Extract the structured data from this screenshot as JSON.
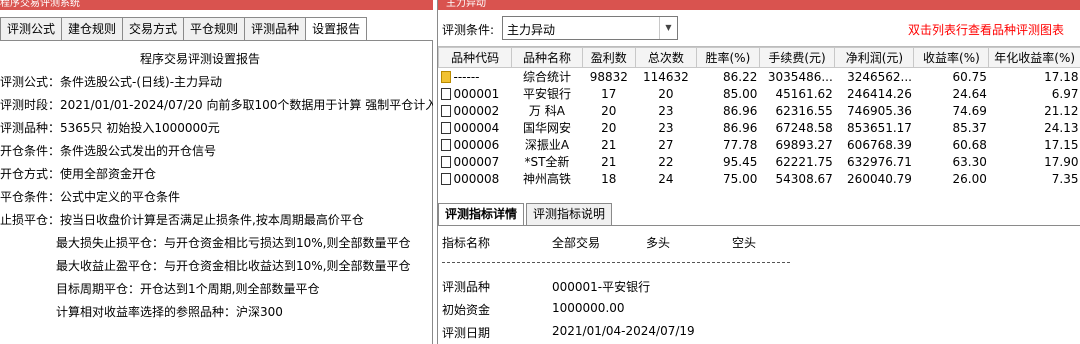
{
  "left_window": {
    "title": "程序交易评测系统",
    "tabs": [
      "评测公式",
      "建仓规则",
      "交易方式",
      "平仓规则",
      "评测品种",
      "设置报告"
    ],
    "report": {
      "title": "程序交易评测设置报告",
      "lines": [
        "评测公式：条件选股公式-(日线)-主力异动",
        "评测时段：2021/01/01-2024/07/20 向前多取100个数据用于计算 强制平仓计入收益",
        "评测品种：5365只 初始投入1000000元",
        "开仓条件：条件选股公式发出的开仓信号",
        "开仓方式：使用全部资金开仓",
        "平仓条件：公式中定义的平仓条件",
        "止损平仓：按当日收盘价计算是否满足止损条件,按本周期最高价平仓"
      ],
      "indent_lines": [
        "最大损失止损平仓：与开仓资金相比亏损达到10%,则全部数量平仓",
        "最大收益止盈平仓：与开仓资金相比收益达到10%,则全部数量平仓",
        "目标周期平仓：开仓达到1个周期,则全部数量平仓",
        "计算相对收益率选择的参照品种：沪深300"
      ]
    }
  },
  "right_window": {
    "title": "主力异动",
    "filter": {
      "label": "评测条件:",
      "value": "主力异动"
    },
    "hint": "双击列表行查看品种评测图表",
    "table": {
      "headers": [
        "品种代码",
        "品种名称",
        "盈利数",
        "总次数",
        "胜率(%)",
        "手续费(元)",
        "净利润(元)",
        "收益率(%)",
        "年化收益率(%)"
      ],
      "rows": [
        [
          "------",
          "综合统计",
          "98832",
          "114632",
          "86.22",
          "3035486...",
          "3246562...",
          "60.75",
          "17.18"
        ],
        [
          "000001",
          "平安银行",
          "17",
          "20",
          "85.00",
          "45161.62",
          "246414.26",
          "24.64",
          "6.97"
        ],
        [
          "000002",
          "万 科A",
          "20",
          "23",
          "86.96",
          "62316.55",
          "746905.36",
          "74.69",
          "21.12"
        ],
        [
          "000004",
          "国华网安",
          "20",
          "23",
          "86.96",
          "67248.58",
          "853651.17",
          "85.37",
          "24.13"
        ],
        [
          "000006",
          "深振业A",
          "21",
          "27",
          "77.78",
          "69893.27",
          "606768.39",
          "60.68",
          "17.15"
        ],
        [
          "000007",
          "*ST全新",
          "21",
          "22",
          "95.45",
          "62221.75",
          "632976.71",
          "63.30",
          "17.90"
        ],
        [
          "000008",
          "神州高铁",
          "18",
          "24",
          "75.00",
          "54308.67",
          "260040.79",
          "26.00",
          "7.35"
        ]
      ]
    },
    "bottom_tabs": [
      "评测指标详情",
      "评测指标说明"
    ],
    "detail": {
      "headers": [
        "指标名称",
        "全部交易",
        "多头",
        "空头"
      ],
      "rows": [
        {
          "label": "评测品种",
          "value": "000001-平安银行"
        },
        {
          "label": "初始资金",
          "value": "1000000.00"
        },
        {
          "label": "评测日期",
          "value": "2021/01/04-2024/07/19"
        }
      ]
    }
  }
}
